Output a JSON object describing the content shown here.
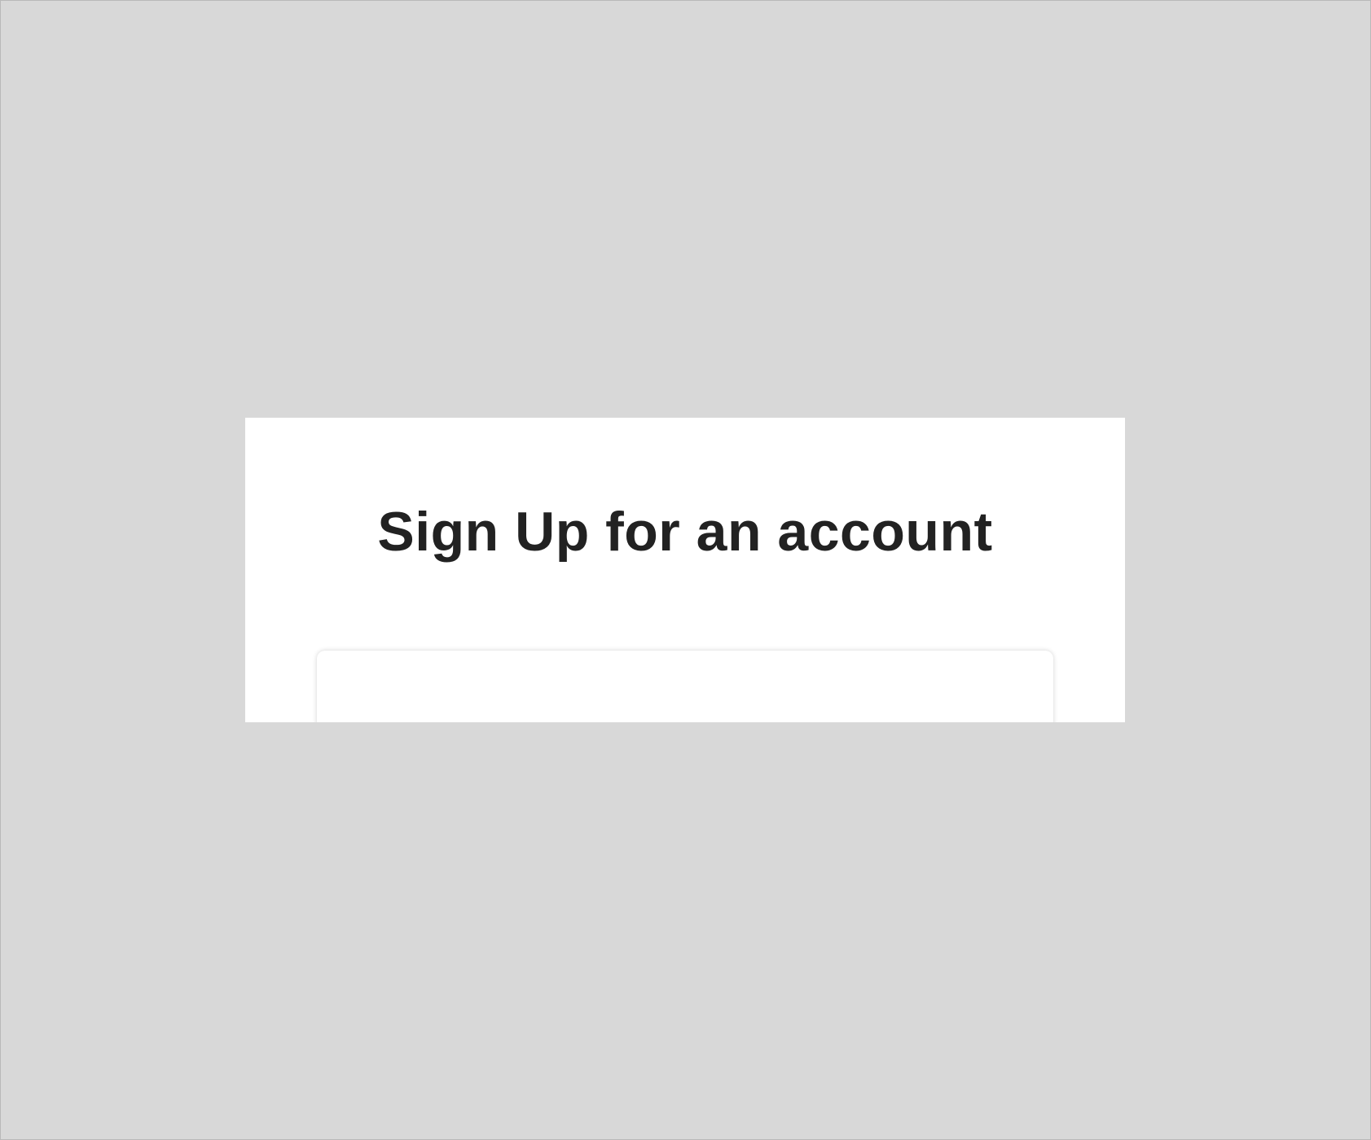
{
  "page": {
    "title": "Sign Up for an account"
  }
}
